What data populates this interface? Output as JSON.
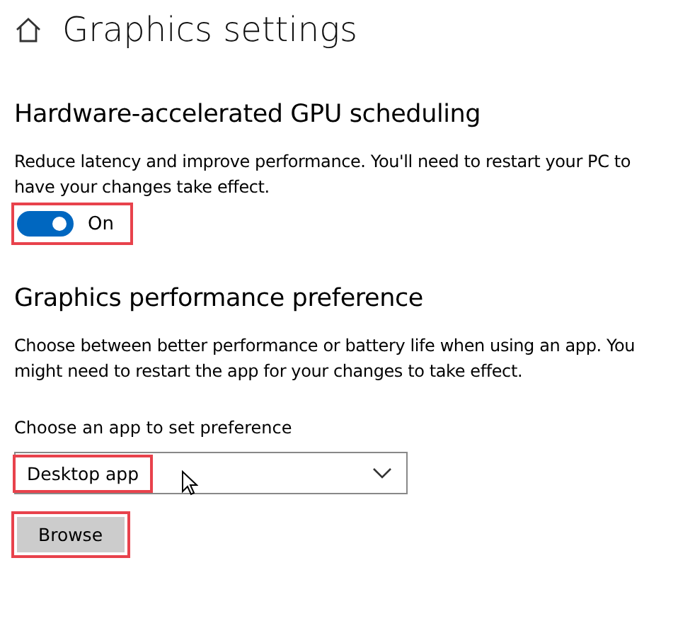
{
  "page": {
    "title": "Graphics settings"
  },
  "gpu_scheduling": {
    "heading": "Hardware-accelerated GPU scheduling",
    "description": "Reduce latency and improve performance. You'll need to restart your PC to have your changes take effect.",
    "toggle": {
      "on": true,
      "label": "On",
      "highlighted": true
    }
  },
  "performance_preference": {
    "heading": "Graphics performance preference",
    "description": "Choose between better performance or battery life when using an app. You might need to restart the app for your changes to take effect.",
    "dropdown_label": "Choose an app to set preference",
    "dropdown": {
      "value": "Desktop app",
      "highlighted": true
    },
    "browse_button": {
      "label": "Browse",
      "highlighted": true
    }
  }
}
